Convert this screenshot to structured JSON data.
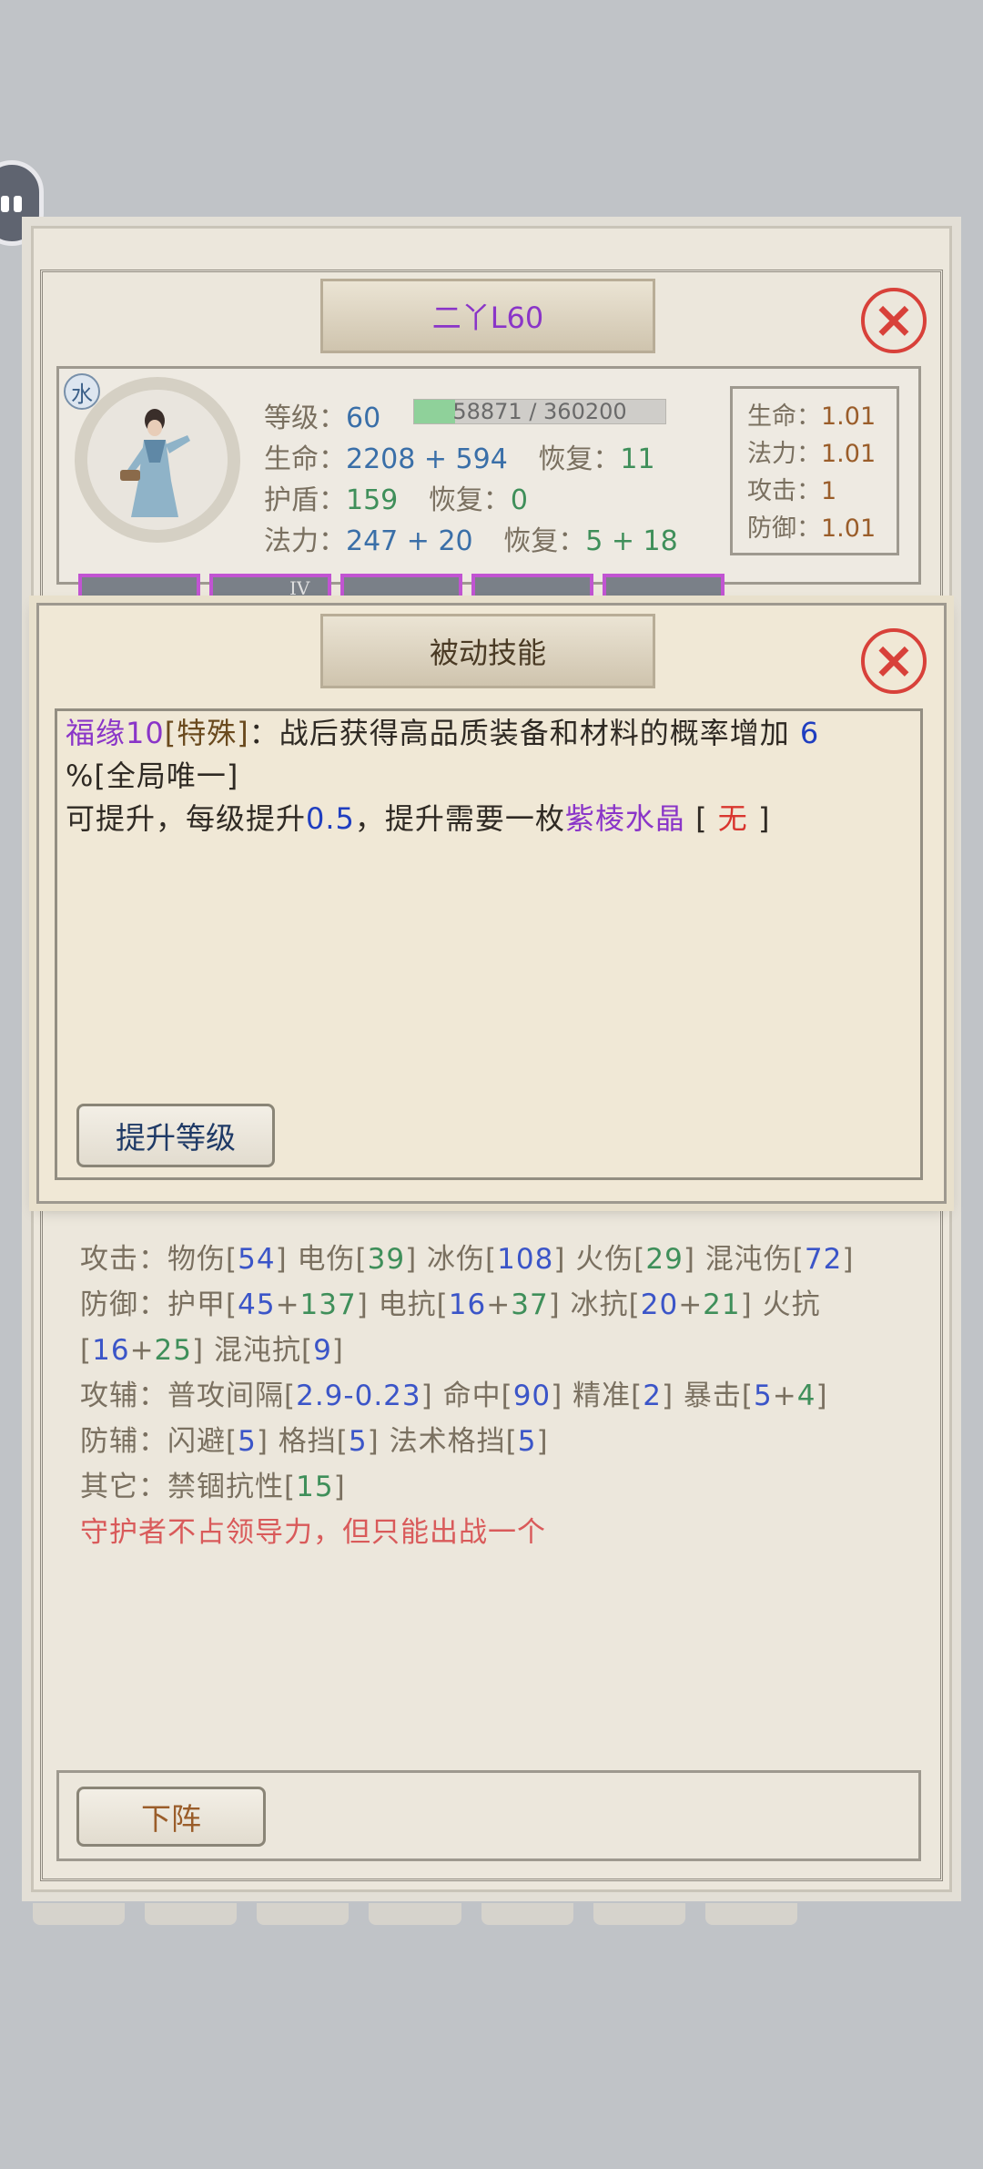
{
  "character": {
    "title": "二丫L60",
    "element": "水",
    "level_label": "等级：",
    "level": "60",
    "exp_text": "58871 / 360200",
    "exp_progress": 0.1634,
    "hp_label": "生命：",
    "hp": "2208 + 594",
    "hp_regen_label": "恢复：",
    "hp_regen": "11",
    "shield_label": "护盾：",
    "shield": "159",
    "shield_regen_label": "恢复：",
    "shield_regen": "0",
    "mana_label": "法力：",
    "mana": "247 + 20",
    "mana_regen_label": "恢复：",
    "mana_regen": "5 + 18"
  },
  "ratios": [
    {
      "label": "生命：",
      "value": "1.01"
    },
    {
      "label": "法力：",
      "value": "1.01"
    },
    {
      "label": "攻击：",
      "value": "1"
    },
    {
      "label": "防御：",
      "value": "1.01"
    }
  ],
  "equipment_slot_mark": "IV",
  "popup": {
    "title": "被动技能",
    "skill_name": "福缘10",
    "skill_type": "[特殊]",
    "desc_a": "：战后获得高品质装备和材料的概率增加",
    "desc_value": "6",
    "desc_b": "%[全局唯一]",
    "upgrade_a": "可提升，每级提升",
    "upgrade_step": "0.5",
    "upgrade_b": "，提升需要一枚",
    "upgrade_item": "紫棱水晶",
    "upgrade_c": "[",
    "upgrade_have": "无",
    "upgrade_d": "]",
    "upgrade_button": "提升等级"
  },
  "attributes": {
    "attack_label": "攻击：",
    "attack": [
      {
        "name": "物伤",
        "value": "54"
      },
      {
        "name": "电伤",
        "value": "39"
      },
      {
        "name": "冰伤",
        "value": "108"
      },
      {
        "name": "火伤",
        "value": "29"
      },
      {
        "name": "混沌伤",
        "value": "72"
      }
    ],
    "defense_label": "防御：",
    "defense": [
      {
        "name": "护甲",
        "base": "45",
        "bonus": "137"
      },
      {
        "name": "电抗",
        "base": "16",
        "bonus": "37"
      },
      {
        "name": "冰抗",
        "base": "20",
        "bonus": "21"
      },
      {
        "name": "火抗",
        "base": "16",
        "bonus": "25"
      }
    ],
    "chaos_res_name": "混沌抗",
    "chaos_res": "9",
    "attack_aux_label": "攻辅：",
    "interval_name": "普攻间隔",
    "interval": "2.9-0.23",
    "hit_name": "命中",
    "hit": "90",
    "precision_name": "精准",
    "precision": "2",
    "crit_name": "暴击",
    "crit_base": "5",
    "crit_bonus": "4",
    "defense_aux_label": "防辅：",
    "dodge_name": "闪避",
    "dodge": "5",
    "block_name": "格挡",
    "block": "5",
    "spell_block_name": "法术格挡",
    "spell_block": "5",
    "other_label": "其它：",
    "imprison_name": "禁锢抗性",
    "imprison": "15",
    "warning": "守护者不占领导力，但只能出战一个"
  },
  "dismiss_button": "下阵",
  "colors": {
    "accent_purple": "#8a35c8",
    "close_red": "#d8413a",
    "stat_green": "#3f8f5a",
    "stat_blue": "#3b55c8",
    "warning_red": "#d95a5a"
  }
}
